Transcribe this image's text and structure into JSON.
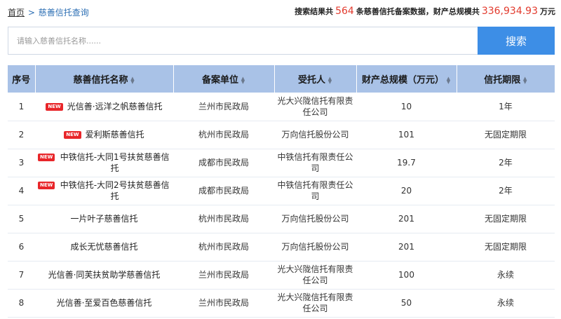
{
  "breadcrumb": {
    "home": "首页",
    "separator": ">",
    "current": "慈善信托查询"
  },
  "summary": {
    "prefix": "搜索结果共",
    "count": "564",
    "middle": "条慈善信托备案数据，财产总规模共",
    "total": "336,934.93",
    "unit": "万元"
  },
  "search": {
    "placeholder": "请输入慈善信托名称......",
    "button_label": "搜索"
  },
  "table": {
    "headers": {
      "index": "序号",
      "name": "慈善信托名称",
      "registry": "备案单位",
      "trustee": "受托人",
      "scale": "财产总规模（万元）",
      "term": "信托期限"
    },
    "new_badge": "NEW",
    "rows": [
      {
        "index": "1",
        "is_new": true,
        "name": "光信善·远洋之帆慈善信托",
        "registry": "兰州市民政局",
        "trustee": "光大兴陇信托有限责任公司",
        "scale": "10",
        "term": "1年"
      },
      {
        "index": "2",
        "is_new": true,
        "name": "爱利斯慈善信托",
        "registry": "杭州市民政局",
        "trustee": "万向信托股份公司",
        "scale": "101",
        "term": "无固定期限"
      },
      {
        "index": "3",
        "is_new": true,
        "name": "中铁信托-大同1号扶贫慈善信托",
        "registry": "成都市民政局",
        "trustee": "中铁信托有限责任公司",
        "scale": "19.7",
        "term": "2年"
      },
      {
        "index": "4",
        "is_new": true,
        "name": "中铁信托-大同2号扶贫慈善信托",
        "registry": "成都市民政局",
        "trustee": "中铁信托有限责任公司",
        "scale": "20",
        "term": "2年"
      },
      {
        "index": "5",
        "is_new": false,
        "name": "一片叶子慈善信托",
        "registry": "杭州市民政局",
        "trustee": "万向信托股份公司",
        "scale": "201",
        "term": "无固定期限"
      },
      {
        "index": "6",
        "is_new": false,
        "name": "成长无忧慈善信托",
        "registry": "杭州市民政局",
        "trustee": "万向信托股份公司",
        "scale": "201",
        "term": "无固定期限"
      },
      {
        "index": "7",
        "is_new": false,
        "name": "光信善·同芙扶贫助学慈善信托",
        "registry": "兰州市民政局",
        "trustee": "光大兴陇信托有限责任公司",
        "scale": "100",
        "term": "永续"
      },
      {
        "index": "8",
        "is_new": false,
        "name": "光信善·至爱百色慈善信托",
        "registry": "兰州市民政局",
        "trustee": "光大兴陇信托有限责任公司",
        "scale": "50",
        "term": "永续"
      }
    ]
  },
  "colors": {
    "accent": "#3d8ee6",
    "header_bg": "#a9c2e7",
    "highlight": "#e23b2e",
    "badge": "#e8262a"
  },
  "icons": {
    "sort": "sort-up-down-icon"
  }
}
